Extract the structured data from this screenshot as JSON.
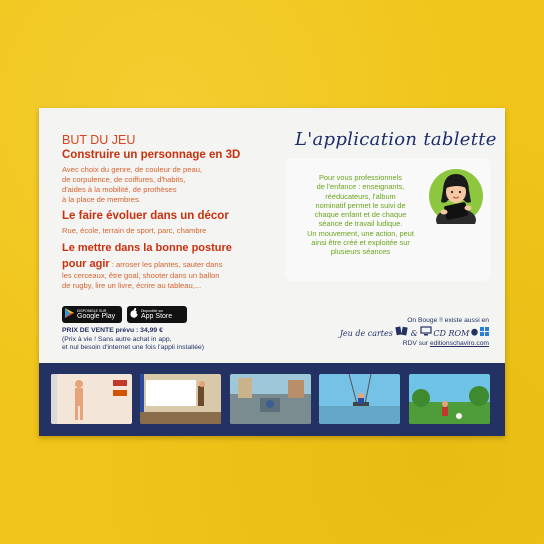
{
  "left": {
    "title": "BUT DU JEU",
    "head1": "Construire un personnage en 3D",
    "text1": [
      "Avec choix du genre, de couleur de peau,",
      "de corpulence, de coiffures, d'habits,",
      "d'aides à la mobilité, de prothèses",
      "à la place de membres."
    ],
    "head2": "Le faire évoluer dans un décor",
    "text2": "Rue, école, terrain de sport, parc, chambre",
    "head3_line1": "Le mettre dans la bonne posture",
    "head3_line2": "pour agir",
    "text3_first": " : arroser les plantes, sauter dans",
    "text3": [
      "les cerceaux, être goal, shooter dans un ballon",
      "de rugby, lire un livre, écrire au tableau,..."
    ]
  },
  "stores": {
    "google_small": "DISPONIBLE SUR",
    "google_big": "Google Play",
    "apple_small": "Disponible sur",
    "apple_big": "App Store"
  },
  "price": {
    "label": "PRIX DE VENTE prévu : 34,99 €",
    "line2": "(Prix à vie ! Sans autre achat in app,",
    "line3": "et nul besoin d'internet une fois l'appli installée)"
  },
  "right": {
    "title": "L'application tablette",
    "text": [
      "Pour vous professionnels",
      "de l'enfance : enseignants,",
      "rééducateurs, l'album",
      "nominatif permet le suivi de",
      "chaque enfant et de chaque",
      "séance de travail ludique.",
      "Un mouvement, une action, peut",
      "ainsi être créé et exploitée sur",
      "plusieurs séances"
    ]
  },
  "also": {
    "line1": "On Bouge !! existe aussi en",
    "cards": "Jeu de cartes",
    "amp": "&",
    "cdrom": "CD ROM",
    "rdv": "RDV sur",
    "site": "editionschaviro.com"
  },
  "colors": {
    "background": "#f0c418",
    "orange": "#d8441c",
    "navy": "#233163",
    "green": "#6aa51e"
  }
}
